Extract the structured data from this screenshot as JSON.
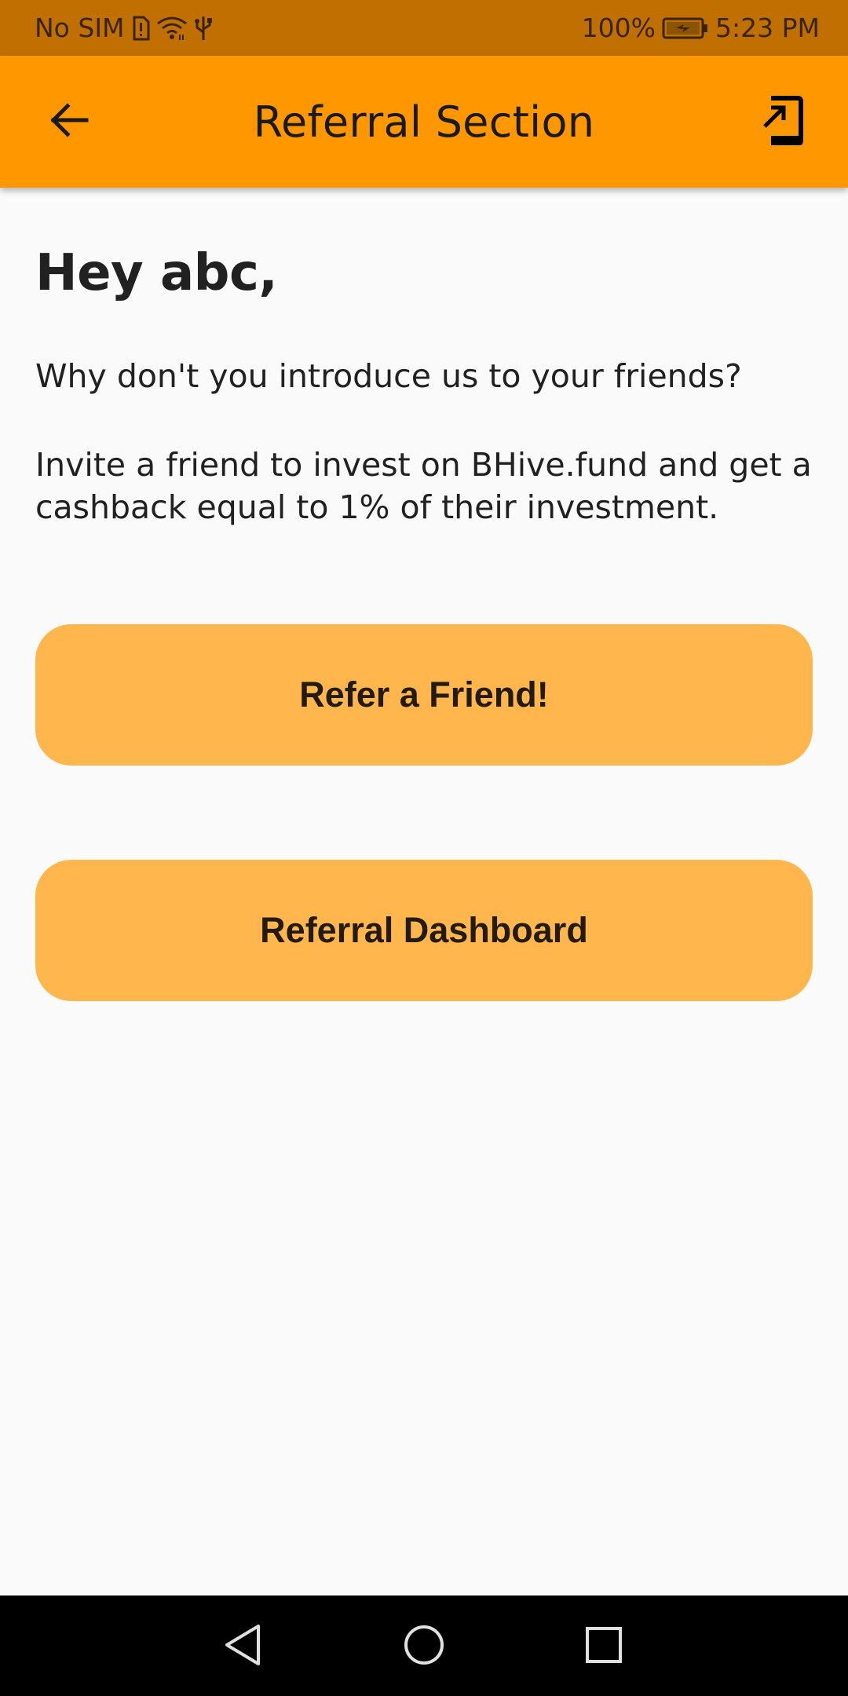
{
  "status_bar": {
    "carrier": "No SIM",
    "battery_percent": "100%",
    "time": "5:23 PM",
    "icons": [
      "sim-alert-icon",
      "wifi-icon",
      "usb-icon",
      "battery-charging-icon"
    ]
  },
  "app_bar": {
    "title": "Referral Section",
    "back_icon": "arrow-back-icon",
    "logout_icon": "logout-icon",
    "color": "#ff9800"
  },
  "main": {
    "greeting": "Hey abc,",
    "intro": "Why don't you introduce us to your friends?",
    "invite_text": "Invite a friend to invest on BHive.fund and get a cashback equal to 1% of their investment.",
    "refer_button_label": "Refer a Friend!",
    "dashboard_button_label": "Referral Dashboard",
    "button_color": "#ffb74d"
  },
  "nav_bar": {
    "icons": [
      "nav-back-icon",
      "nav-home-icon",
      "nav-recents-icon"
    ]
  }
}
